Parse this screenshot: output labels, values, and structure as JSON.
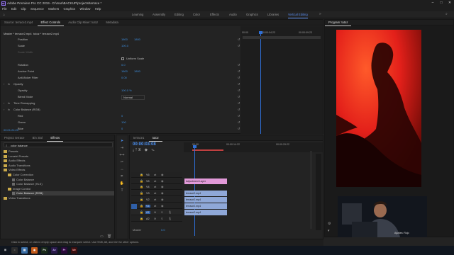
{
  "window": {
    "title": "Adobe Premiere Pro CC 2019 - D:\\man\\BACKUP\\projects\\terrace *",
    "app_icon_label": "Pr"
  },
  "menu": [
    "File",
    "Edit",
    "Clip",
    "Sequence",
    "Markers",
    "Graphics",
    "Window",
    "Help"
  ],
  "workspaces": [
    "Learning",
    "Assembly",
    "Editing",
    "Color",
    "Effects",
    "Audio",
    "Graphics",
    "Libraries",
    "Vertical Editing"
  ],
  "active_workspace": "Vertical Editing",
  "source_panel": {
    "tabs": [
      "Source: terrace2.mp4",
      "Effect Controls",
      "Audio Clip Mixer: tutoz",
      "Metadata"
    ],
    "active_tab": "Effect Controls",
    "clip_path": "Master * terrace2.mp4",
    "clip_name": "tutoz * terrace2.mp4",
    "ruler": [
      "00:00",
      "00:00:04:23",
      "00:00:09:23"
    ],
    "timecode": "00:01:24:20",
    "properties": [
      {
        "label": "Position",
        "v1": "1800",
        "v2": "1800",
        "indent": 2
      },
      {
        "label": "Scale",
        "v1": "100.0",
        "v2": "",
        "indent": 2
      },
      {
        "label": "Scale Width",
        "v1": "",
        "v2": "",
        "indent": 2,
        "dim": true
      },
      {
        "label": "Uniform Scale",
        "v1": "",
        "v2": "",
        "indent": 2,
        "checkbox": true
      },
      {
        "label": "Rotation",
        "v1": "0.0",
        "v2": "",
        "indent": 2
      },
      {
        "label": "Anchor Point",
        "v1": "1800",
        "v2": "1800",
        "indent": 2
      },
      {
        "label": "Anti-flicker Filter",
        "v1": "0.00",
        "v2": "",
        "indent": 2
      },
      {
        "label": "Opacity",
        "v1": "",
        "v2": "",
        "indent": 1,
        "fx": true
      },
      {
        "label": "Opacity",
        "v1": "100.0 %",
        "v2": "",
        "indent": 2
      },
      {
        "label": "Blend Mode",
        "v1": "Normal",
        "v2": "",
        "indent": 2,
        "dropdown": true
      },
      {
        "label": "Time Remapping",
        "v1": "",
        "v2": "",
        "indent": 1,
        "fx": true
      },
      {
        "label": "Color Balance (RGB)",
        "v1": "",
        "v2": "",
        "indent": 1,
        "fx": true
      },
      {
        "label": "Red",
        "v1": "0",
        "v2": "",
        "indent": 2
      },
      {
        "label": "Green",
        "v1": "100",
        "v2": "",
        "indent": 2
      },
      {
        "label": "Blue",
        "v1": "0",
        "v2": "",
        "indent": 2
      }
    ]
  },
  "program_monitor": {
    "title": "Program: tutoz",
    "right_timecode": "00:00:00",
    "overlay_text": "Ajustes: Rojo"
  },
  "project_panel": {
    "tabs": [
      "Project: terrace",
      "Bin: Bol",
      "Effects"
    ],
    "active_tab": "Effects",
    "search_value": "color balance",
    "tree": [
      {
        "label": "Presets",
        "indent": 1
      },
      {
        "label": "Lumetri Presets",
        "indent": 1
      },
      {
        "label": "Audio Effects",
        "indent": 1
      },
      {
        "label": "Audio Transitions",
        "indent": 1
      },
      {
        "label": "Video Effects",
        "indent": 1
      },
      {
        "label": "Color Correction",
        "indent": 2
      },
      {
        "label": "Color Balance",
        "indent": 3,
        "file": true
      },
      {
        "label": "Color Balance (HLS)",
        "indent": 3,
        "file": true
      },
      {
        "label": "Image Control",
        "indent": 2
      },
      {
        "label": "Color Balance (RGB)",
        "indent": 3,
        "file": true,
        "selected": true
      },
      {
        "label": "Video Transitions",
        "indent": 1
      }
    ]
  },
  "timeline": {
    "tabs": [
      "terrace1",
      "tutoz"
    ],
    "active_tab": "tutoz",
    "timecode": "00:00:03:08",
    "ruler": [
      "00:00",
      "00:00:14:22",
      "00:00:29:22"
    ],
    "tracks": [
      {
        "name": "V6",
        "label": "V6"
      },
      {
        "name": "V5",
        "label": "V5"
      },
      {
        "name": "V4",
        "label": "V4"
      },
      {
        "name": "V3",
        "label": "V3"
      },
      {
        "name": "V2",
        "label": "V2"
      },
      {
        "name": "V1",
        "label": "V1"
      },
      {
        "name": "A1",
        "label": "A1"
      },
      {
        "name": "A2",
        "label": "A2"
      }
    ],
    "clips": [
      {
        "label": "Adjustment Layer",
        "type": "adjustment"
      },
      {
        "label": "terrace2.mp4",
        "type": "video"
      },
      {
        "label": "terrace2.mp4",
        "type": "video"
      },
      {
        "label": "terrace2.mp4",
        "type": "video"
      },
      {
        "label": "terrace2.mp4",
        "type": "video"
      }
    ],
    "master_label": "Master",
    "master_value": "0.0"
  },
  "status_bar": {
    "text": "Click to select, or click in empty space and drag to marquee select. Use Shift, Alt, and Ctrl for other options."
  },
  "taskbar": {
    "time": "",
    "date": ""
  },
  "colors": {
    "accent": "#4a8ff0",
    "playhead": "#2f6fd6",
    "adjustment_clip": "#e29ad9",
    "video_clip": "#8fa8d8",
    "program_red": "#e3201a"
  }
}
